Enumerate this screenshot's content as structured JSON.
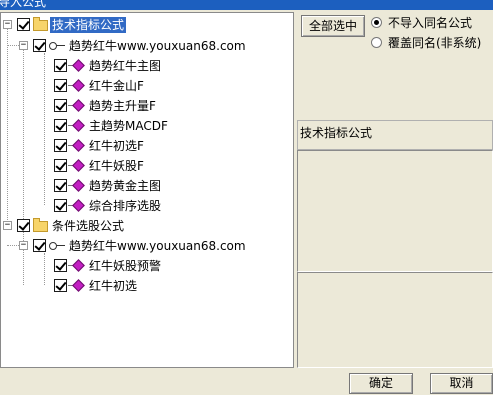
{
  "window": {
    "title": "导入公式"
  },
  "tree": {
    "nodes": [
      {
        "id": "n0",
        "label": "技术指标公式"
      },
      {
        "id": "n1",
        "label": "趋势红牛www.youxuan68.com"
      },
      {
        "id": "n2",
        "label": "趋势红牛主图"
      },
      {
        "id": "n3",
        "label": "红牛金山F"
      },
      {
        "id": "n4",
        "label": "趋势主升量F"
      },
      {
        "id": "n5",
        "label": "主趋势MACDF"
      },
      {
        "id": "n6",
        "label": "红牛初选F"
      },
      {
        "id": "n7",
        "label": "红牛妖股F"
      },
      {
        "id": "n8",
        "label": "趋势黄金主图"
      },
      {
        "id": "n9",
        "label": "综合排序选股"
      },
      {
        "id": "n10",
        "label": "条件选股公式"
      },
      {
        "id": "n11",
        "label": "趋势红牛www.youxuan68.com"
      },
      {
        "id": "n12",
        "label": "红牛妖股预警"
      },
      {
        "id": "n13",
        "label": "红牛初选"
      }
    ],
    "expander_collapse": "−"
  },
  "right": {
    "select_all_label": "全部选中",
    "radio_no_import": "不导入同名公式",
    "radio_overwrite": "覆盖同名(非系统)",
    "category_label": "技术指标公式"
  },
  "footer": {
    "ok_label": "确定",
    "cancel_label": "取消"
  }
}
